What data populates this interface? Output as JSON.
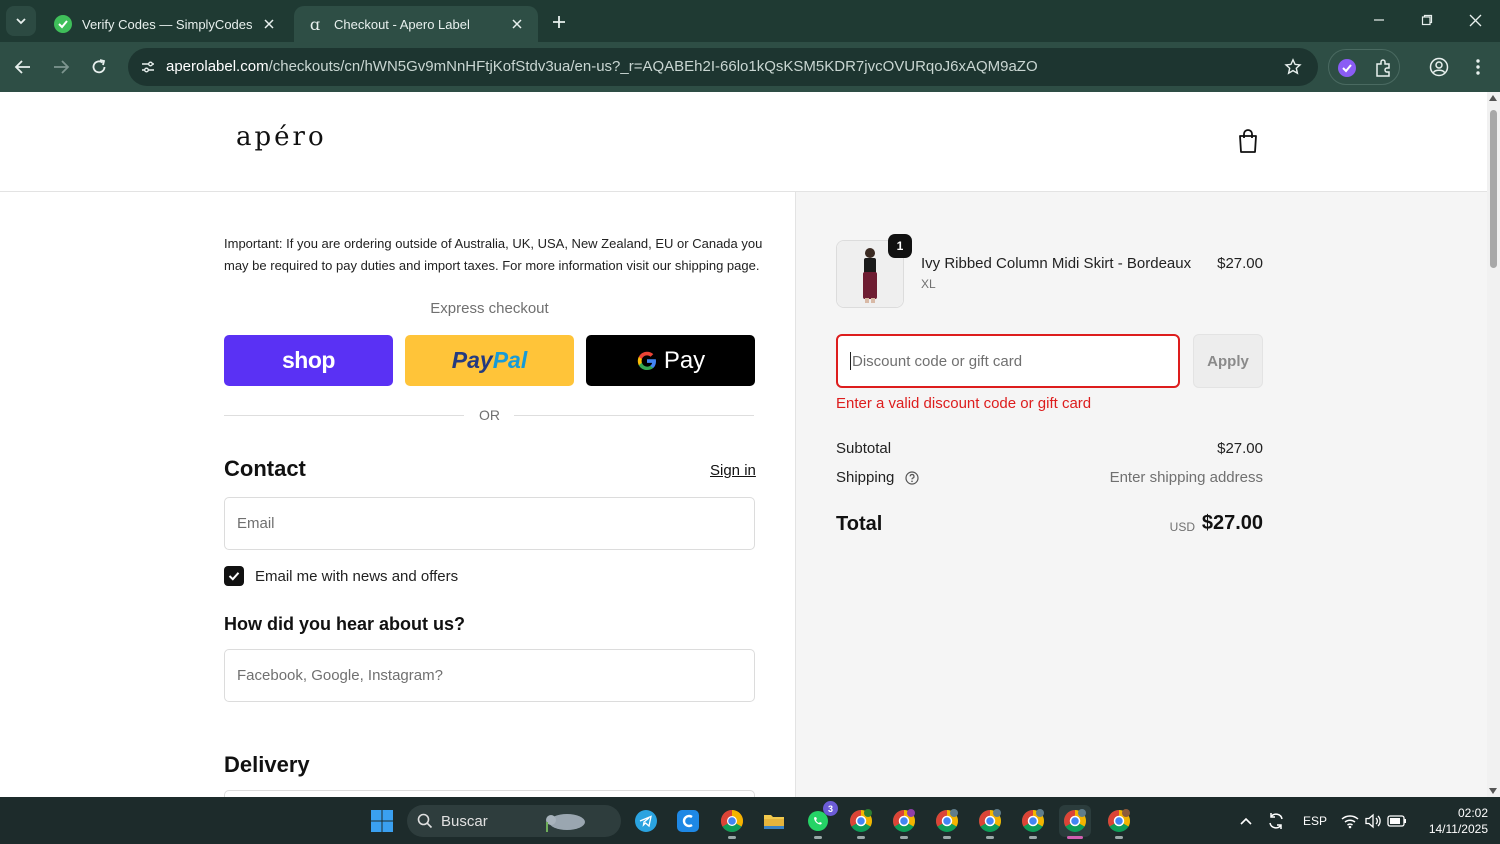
{
  "browser": {
    "tabs": [
      {
        "title": "Verify Codes — SimplyCodes",
        "active": false
      },
      {
        "title": "Checkout - Apero Label",
        "active": true
      }
    ],
    "url_host": "aperolabel.com",
    "url_path": "/checkouts/cn/hWN5Gv9mNnHFtjKofStdv3ua/en-us?_r=AQABEh2I-66lo1kQsKSM5KDR7jvcOVURqoJ6xAQM9aZO"
  },
  "header": {
    "logo": "apéro"
  },
  "checkout": {
    "notice": "Important: If you are ordering outside of Australia, UK, USA, New Zealand, EU or Canada you may be required to pay duties and import taxes. For more information visit our shipping page.",
    "express_label": "Express checkout",
    "shop_label": "shop",
    "paypal_label_1": "Pay",
    "paypal_label_2": "Pal",
    "gpay_label": "Pay",
    "or_label": "OR",
    "contact_heading": "Contact",
    "signin_label": "Sign in",
    "email_placeholder": "Email",
    "newsletter_label": "Email me with news and offers",
    "newsletter_checked": true,
    "hear_heading": "How did you hear about us?",
    "hear_placeholder": "Facebook, Google, Instagram?",
    "delivery_heading": "Delivery"
  },
  "summary": {
    "item": {
      "name": "Ivy Ribbed Column Midi Skirt - Bordeaux",
      "variant": "XL",
      "price": "$27.00",
      "quantity": "1"
    },
    "discount_placeholder": "Discount code or gift card",
    "apply_label": "Apply",
    "error": "Enter a valid discount code or gift card",
    "subtotal_label": "Subtotal",
    "subtotal_value": "$27.00",
    "shipping_label": "Shipping",
    "shipping_value": "Enter shipping address",
    "total_label": "Total",
    "total_currency": "USD",
    "total_value": "$27.00"
  },
  "taskbar": {
    "search_label": "Buscar",
    "whatsapp_badge": "3",
    "language": "ESP",
    "time": "02:02",
    "date": "14/11/2025"
  },
  "colors": {
    "accent_error": "#dd1d1d",
    "shop_purple": "#5a31f4",
    "paypal_yellow": "#ffc439",
    "browser_frame": "#1f3a33"
  }
}
